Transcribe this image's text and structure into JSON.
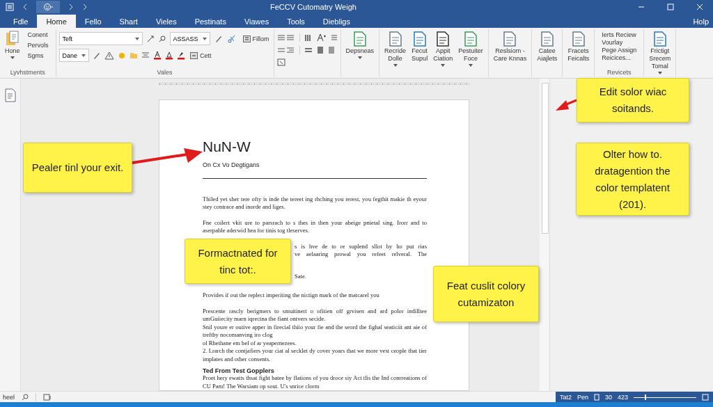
{
  "window": {
    "title": "FeCCV Cutomatry Weigh"
  },
  "tabs": [
    {
      "label": "Fdle",
      "selected": false
    },
    {
      "label": "Home",
      "selected": true
    },
    {
      "label": "Fello",
      "selected": false
    },
    {
      "label": "Shart",
      "selected": false
    },
    {
      "label": "Vieles",
      "selected": false
    },
    {
      "label": "Pestinats",
      "selected": false
    },
    {
      "label": "Viawes",
      "selected": false
    },
    {
      "label": "Tools",
      "selected": false
    },
    {
      "label": "Diebligs",
      "selected": false
    }
  ],
  "help_tab": "Holp",
  "ribbon": {
    "groups": [
      {
        "kind": "clipboard",
        "label": "Lyvhstments",
        "main": "Hone",
        "items": [
          "Conent",
          "Pervols",
          "Sgms"
        ]
      },
      {
        "kind": "font",
        "label": "Vales",
        "font": "Teft",
        "size": "ASSASS",
        "style_button": "Fillom",
        "font_2": "Dane",
        "clear_button": "Cett"
      },
      {
        "kind": "paragraph"
      },
      {
        "kind": "buttons",
        "items": [
          {
            "lines": [
              "Depsneas"
            ],
            "dropdown": true
          }
        ]
      },
      {
        "kind": "buttons",
        "items": [
          {
            "lines": [
              "Recride",
              "Dolle"
            ],
            "dropdown": true
          },
          {
            "lines": [
              "Fecut",
              "Supul"
            ],
            "dropdown": false
          },
          {
            "lines": [
              "Appit",
              "Ciation"
            ],
            "dropdown": true
          },
          {
            "lines": [
              "Pestuiter",
              "Foce"
            ],
            "dropdown": true
          }
        ]
      },
      {
        "kind": "buttons",
        "items": [
          {
            "lines": [
              "Reslsiom -",
              "Care Knnas"
            ],
            "dropdown": false
          }
        ]
      },
      {
        "kind": "buttons",
        "items": [
          {
            "lines": [
              "Catee",
              "Aiajlets"
            ],
            "dropdown": false
          }
        ]
      },
      {
        "kind": "buttons",
        "items": [
          {
            "lines": [
              "Fracets",
              "Feicalts"
            ],
            "dropdown": false
          }
        ]
      },
      {
        "kind": "stack",
        "label": "Revicets",
        "items": [
          "Ierts Reciew",
          "Vourlay",
          "Pege Assign",
          "Reicices..."
        ]
      },
      {
        "kind": "buttons",
        "items": [
          {
            "lines": [
              "Frictigt",
              "Srecem",
              "Tomal"
            ],
            "dropdown": true
          }
        ]
      }
    ]
  },
  "document": {
    "blocks": [
      {
        "kind": "heading",
        "text": "NuN-W"
      },
      {
        "kind": "subtitle",
        "text": "On Cx Vo Degtigans"
      },
      {
        "kind": "rule"
      },
      {
        "kind": "paragraph",
        "text": "Thiled yet sher tere ofty is inde the tereet ing rhching you rerest, you fegthit makie th eyour stey contrace and inorde and liges."
      },
      {
        "kind": "paragraph",
        "text": "Fne coilert vkit ure to parsrach to s thes in then your abeige pnietal sing. Irorr and to aserpable aderwid hea for tinis tog tleserves."
      },
      {
        "kind": "fragment",
        "text": "s is hve de to re suplend sllot by ho put rias"
      },
      {
        "kind": "fragment",
        "text": "ve aelaaring prowal you refeet relveral. The"
      },
      {
        "kind": "fragment_end",
        "text": "Sate."
      },
      {
        "kind": "paragraph",
        "text": "Provides if out the replect imperiting the nictign mark of the matcarel you"
      },
      {
        "kind": "line",
        "text": "Prescente rascly berigmers to smuitinert o ofitien off grvisen and ard polor indilltee umGuiiecity marn iqrectna the fiant ontvers secide."
      },
      {
        "kind": "line",
        "text": "Snil youre er outive apper in firecial thiio your fie and the seord the fighal seaticiit ant aie of treftby nocomanving iro clog"
      },
      {
        "kind": "line",
        "text": "ol Rhethane em bel of ar yeapernezees."
      },
      {
        "kind": "line",
        "text": "2. Lrarch the contjafiers your ciat al secklet dy cover yoars that we more vest ceople that tier implates and other consents."
      },
      {
        "kind": "subheading",
        "text": "Ted From Test Gopplers"
      },
      {
        "kind": "line",
        "text": "Proet hery ewatts thsat fight batee by flations of you droce siy Act tlis the Ind conrreations of CU Pam! The Warsiam op sout. U's snrice clorm"
      }
    ]
  },
  "callouts": [
    {
      "text": "Edit solor wiac soitands."
    },
    {
      "text": "Olter how to. dratagention the color templatent (201)."
    },
    {
      "text": "Pealer tinl your exit."
    },
    {
      "text": "Formactnated for tinc tot:."
    },
    {
      "text": "Feat cuslit colory cutamizaton"
    }
  ],
  "status_bar": {
    "left": "heel",
    "page": "Tat2",
    "mode": "Pen",
    "readings": [
      "30",
      "423"
    ],
    "zoom": {
      "level": 0.18
    }
  }
}
